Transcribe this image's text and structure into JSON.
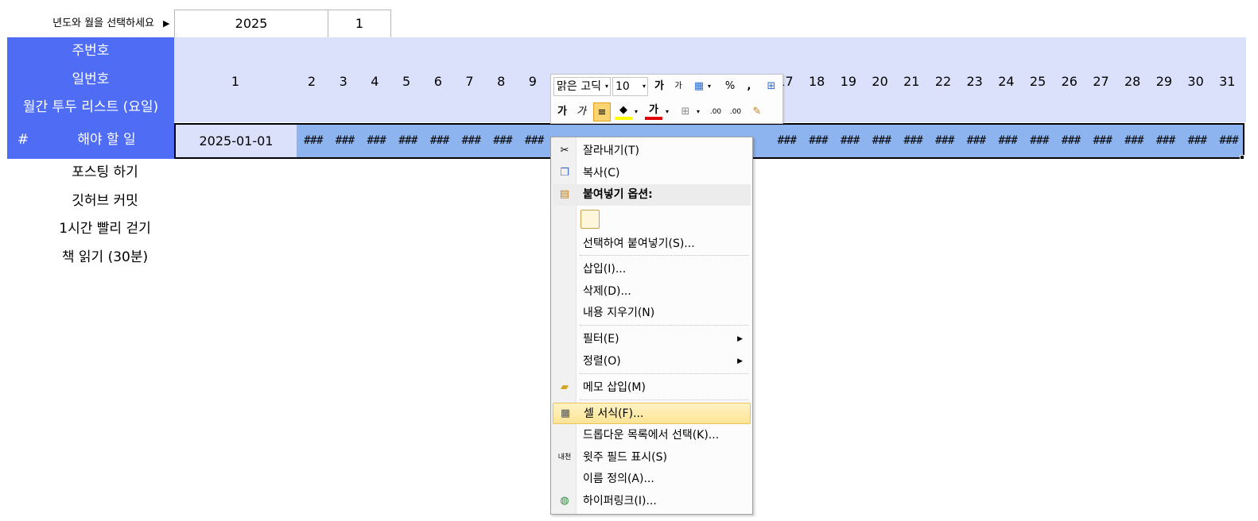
{
  "selector": {
    "label": "년도와 월을 선택하세요",
    "arrow": "▶",
    "year": "2025",
    "month": "1"
  },
  "header": {
    "week_label": "주번호",
    "day_label": "일번호",
    "list_title": "월간 투두 리스트 (요일)",
    "hash_col": "#",
    "todo_col": "해야 할 일",
    "days": [
      "1",
      "2",
      "3",
      "4",
      "5",
      "6",
      "7",
      "8",
      "9",
      "",
      "",
      "",
      "",
      "",
      "",
      "",
      "17",
      "18",
      "19",
      "20",
      "21",
      "22",
      "23",
      "24",
      "25",
      "26",
      "27",
      "28",
      "29",
      "30",
      "31"
    ]
  },
  "row": {
    "date": "2025-01-01",
    "overflow": "###"
  },
  "todos": [
    "포스팅 하기",
    "깃허브 커밋",
    "1시간 빨리 걷기",
    "책 읽기 (30분)"
  ],
  "mini_toolbar": {
    "font_name": "맑은 고딕",
    "font_size": "10",
    "percent": "%",
    "comma": ","
  },
  "context_menu": {
    "cut": "잘라내기(T)",
    "copy": "복사(C)",
    "paste_options": "붙여넣기 옵션:",
    "paste_special": "선택하여 붙여넣기(S)...",
    "insert": "삽입(I)...",
    "delete": "삭제(D)...",
    "clear": "내용 지우기(N)",
    "filter": "필터(E)",
    "sort": "정렬(O)",
    "insert_comment": "메모 삽입(M)",
    "format_cells": "셀 서식(F)...",
    "pick_dropdown": "드롭다운 목록에서 선택(K)...",
    "phonetic": "윗주 필드 표시(S)",
    "define_name": "이름 정의(A)...",
    "hyperlink": "하이퍼링크(I)..."
  },
  "colors": {
    "header_blue": "#4f6cf4",
    "header_light": "#dbe0fb",
    "row_blue": "#8db4ee",
    "highlight": "#fde495"
  }
}
